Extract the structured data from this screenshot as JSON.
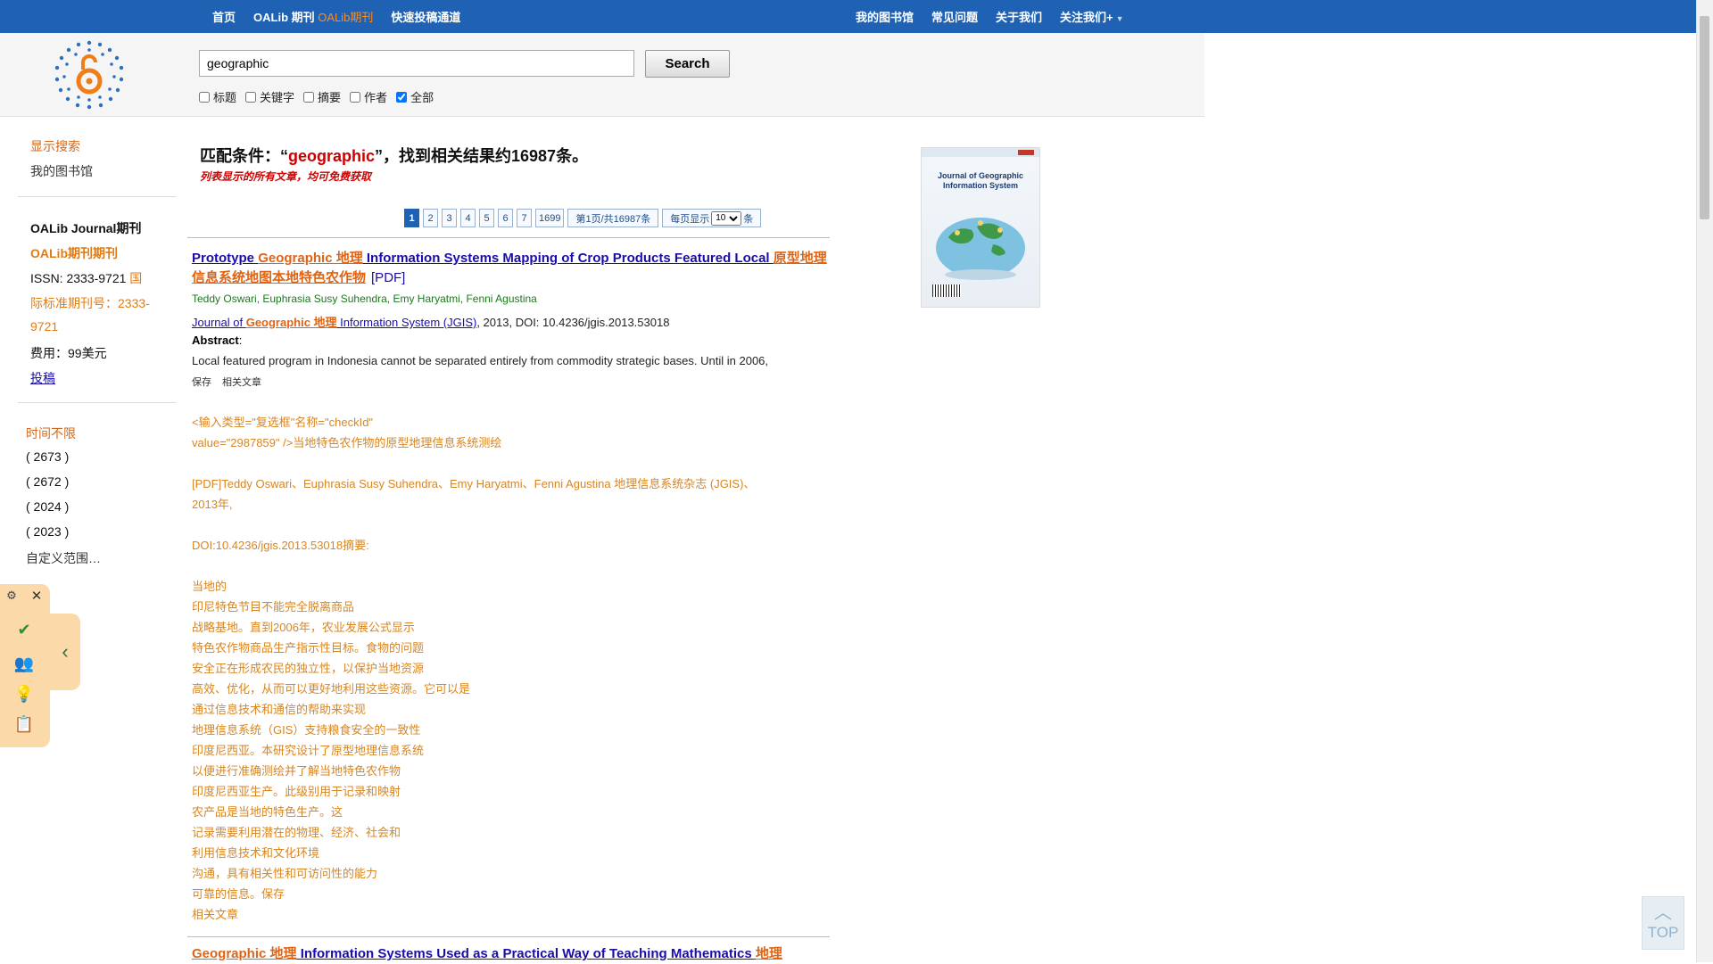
{
  "topnav": {
    "items": [
      "首页",
      "OALib 期刊",
      "OALib期刊",
      "快速投稿通道"
    ],
    "right_items": [
      "我的图书馆",
      "常见问题",
      "关于我们",
      "关注我们+"
    ]
  },
  "search": {
    "value": "geographic",
    "button": "Search",
    "filters": [
      {
        "label": "标题",
        "checked": false
      },
      {
        "label": "关键字",
        "checked": false
      },
      {
        "label": "摘要",
        "checked": false
      },
      {
        "label": "作者",
        "checked": false
      },
      {
        "label": "全部",
        "checked": true
      }
    ]
  },
  "sidebar": {
    "show_search": "显示搜索",
    "my_library": "我的图书馆",
    "journal_title": "OALib Journal期刊",
    "journal_sub": "OALib期刊期刊",
    "issn_label": "ISSN: 2333-9721",
    "issn_cn_1": "国",
    "issn_cn_2": "际标准期刊号：2333-",
    "issn_cn_3": "9721",
    "fee": "费用：99美元",
    "submit": "投稿",
    "time_any": "时间不限",
    "years": [
      "( 2673 )",
      "( 2672 )",
      "( 2024 )",
      "( 2023 )"
    ],
    "custom_range": "自定义范围…"
  },
  "results": {
    "head_prefix": "匹配条件：“",
    "keyword": "geographic",
    "head_suffix": "”，找到相关结果约16987条。",
    "note": "列表显示的所有文章，均可免费获取",
    "pager": {
      "pages": [
        "1",
        "2",
        "3",
        "4",
        "5",
        "6",
        "7",
        "1699"
      ],
      "info": "第1页/共16987条",
      "per_page_label": "每页显示",
      "per_page": "10",
      "unit": "条"
    }
  },
  "result1": {
    "t1": "Prototype ",
    "t2": "Geographic 地理",
    "t3": " Information Systems Mapping of Crop Products Featured Local ",
    "t4": "原型地理信息系统地图本地特色农作物",
    "pdf": "[PDF]",
    "authors": "Teddy Oswari, Euphrasia Susy Suhendra, Emy Haryatmi, Fenni Agustina",
    "journal_a": "Journal of ",
    "journal_b": "Geographic 地理",
    "journal_c": " Information System (JGIS)",
    "journal_rest": ", 2013, DOI: 10.4236/jgis.2013.53018",
    "abstract_label": "Abstract",
    "abstract_colon": ":",
    "abstract": "Local featured program in Indonesia cannot be separated entirely from commodity strategic bases. Until in 2006,",
    "save": "保存",
    "related": "相关文章",
    "translated": [
      "<输入类型=\"复选框\"名称=\"checkId\"",
      "value=\"2987859\" />当地特色农作物的原型地理信息系统测绘",
      "",
      " [PDF]Teddy Oswari、Euphrasia Susy Suhendra、Emy Haryatmi、Fenni Agustina 地理信息系统杂志 (JGIS)、",
      "2013年,",
      "",
      "DOI:10.4236/jgis.2013.53018摘要:",
      "",
      "当地的",
      "印尼特色节目不能完全脱离商品",
      "战略基地。直到2006年，农业发展公式显示",
      "特色农作物商品生产指示性目标。食物的问题",
      "安全正在形成农民的独立性，以保护当地资源",
      "高效、优化，从而可以更好地利用这些资源。它可以是",
      "通过信息技术和通信的帮助来实现",
      "地理信息系统（GIS）支持粮食安全的一致性",
      "印度尼西亚。本研究设计了原型地理信息系统",
      "以便进行准确测绘并了解当地特色农作物",
      "印度尼西亚生产。此级别用于记录和映射",
      "农产品是当地的特色生产。这",
      "记录需要利用潜在的物理、经济、社会和",
      "利用信息技术和文化环境",
      "沟通，具有相关性和可访问性的能力",
      "可靠的信息。保存",
      "相关文章"
    ]
  },
  "result2": {
    "t1": "Geographic 地理",
    "t2": " Information Systems Used as a Practical Way of Teaching Mathematics ",
    "t3": "地理"
  },
  "cover": {
    "title_line1": "Journal of Geographic",
    "title_line2": "Information System"
  },
  "totop": {
    "label": "TOP"
  },
  "colors": {
    "nav": "#1f62b4",
    "accent": "#e06414",
    "keyword": "#cc0000"
  }
}
